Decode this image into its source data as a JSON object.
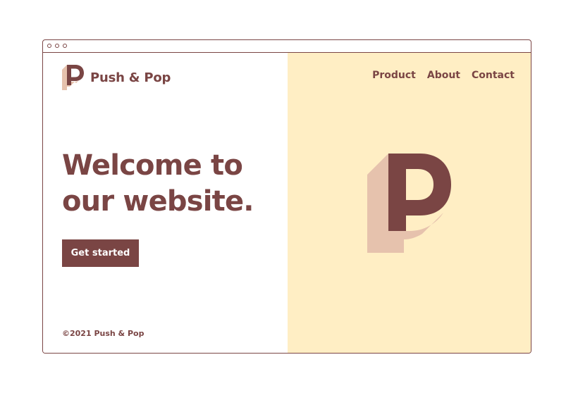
{
  "brand": {
    "name": "Push & Pop",
    "logo_icon": "p-letter-logo-icon"
  },
  "nav": {
    "items": [
      {
        "label": "Product"
      },
      {
        "label": "About"
      },
      {
        "label": "Contact"
      }
    ]
  },
  "hero": {
    "headline_line1": "Welcome to",
    "headline_line2": "our website.",
    "cta_label": "Get started",
    "illustration_icon": "p-letter-illustration-icon"
  },
  "footer": {
    "copyright": "©2021 Push & Pop"
  },
  "colors": {
    "primary": "#7a4544",
    "shadow": "#e6c2ad",
    "panel_background": "#ffeec4",
    "background": "#ffffff"
  }
}
